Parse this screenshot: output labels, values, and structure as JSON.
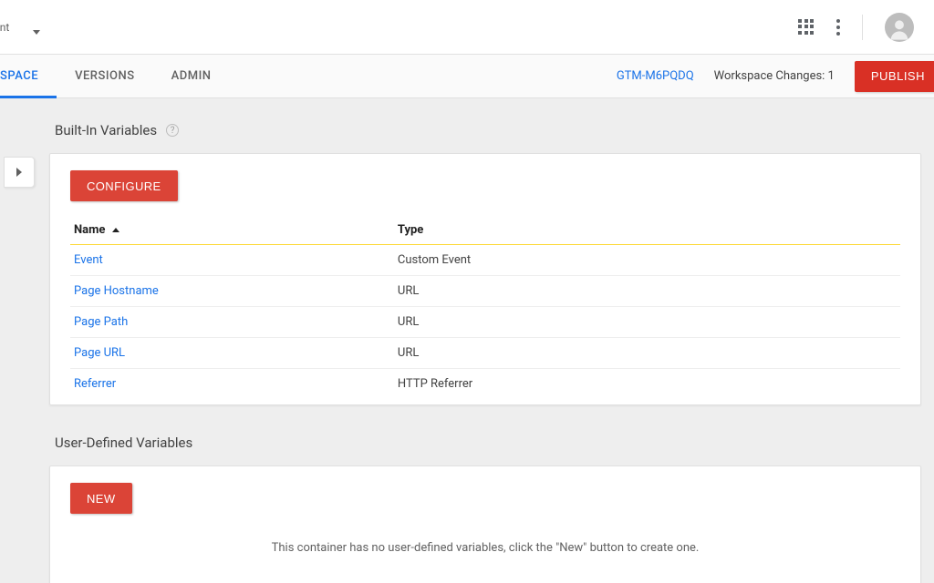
{
  "topbar": {
    "account_label": "count"
  },
  "nav": {
    "tabs": [
      {
        "label": "SPACE",
        "active": true
      },
      {
        "label": "VERSIONS",
        "active": false
      },
      {
        "label": "ADMIN",
        "active": false
      }
    ],
    "container_id": "GTM-M6PQDQ",
    "workspace_changes": "Workspace Changes: 1",
    "publish_label": "PUBLISH"
  },
  "builtin": {
    "title": "Built-In Variables",
    "configure_label": "CONFIGURE",
    "columns": {
      "name": "Name",
      "type": "Type"
    },
    "rows": [
      {
        "name": "Event",
        "type": "Custom Event"
      },
      {
        "name": "Page Hostname",
        "type": "URL"
      },
      {
        "name": "Page Path",
        "type": "URL"
      },
      {
        "name": "Page URL",
        "type": "URL"
      },
      {
        "name": "Referrer",
        "type": "HTTP Referrer"
      }
    ]
  },
  "user_defined": {
    "title": "User-Defined Variables",
    "new_label": "NEW",
    "empty_message": "This container has no user-defined variables, click the \"New\" button to create one."
  }
}
